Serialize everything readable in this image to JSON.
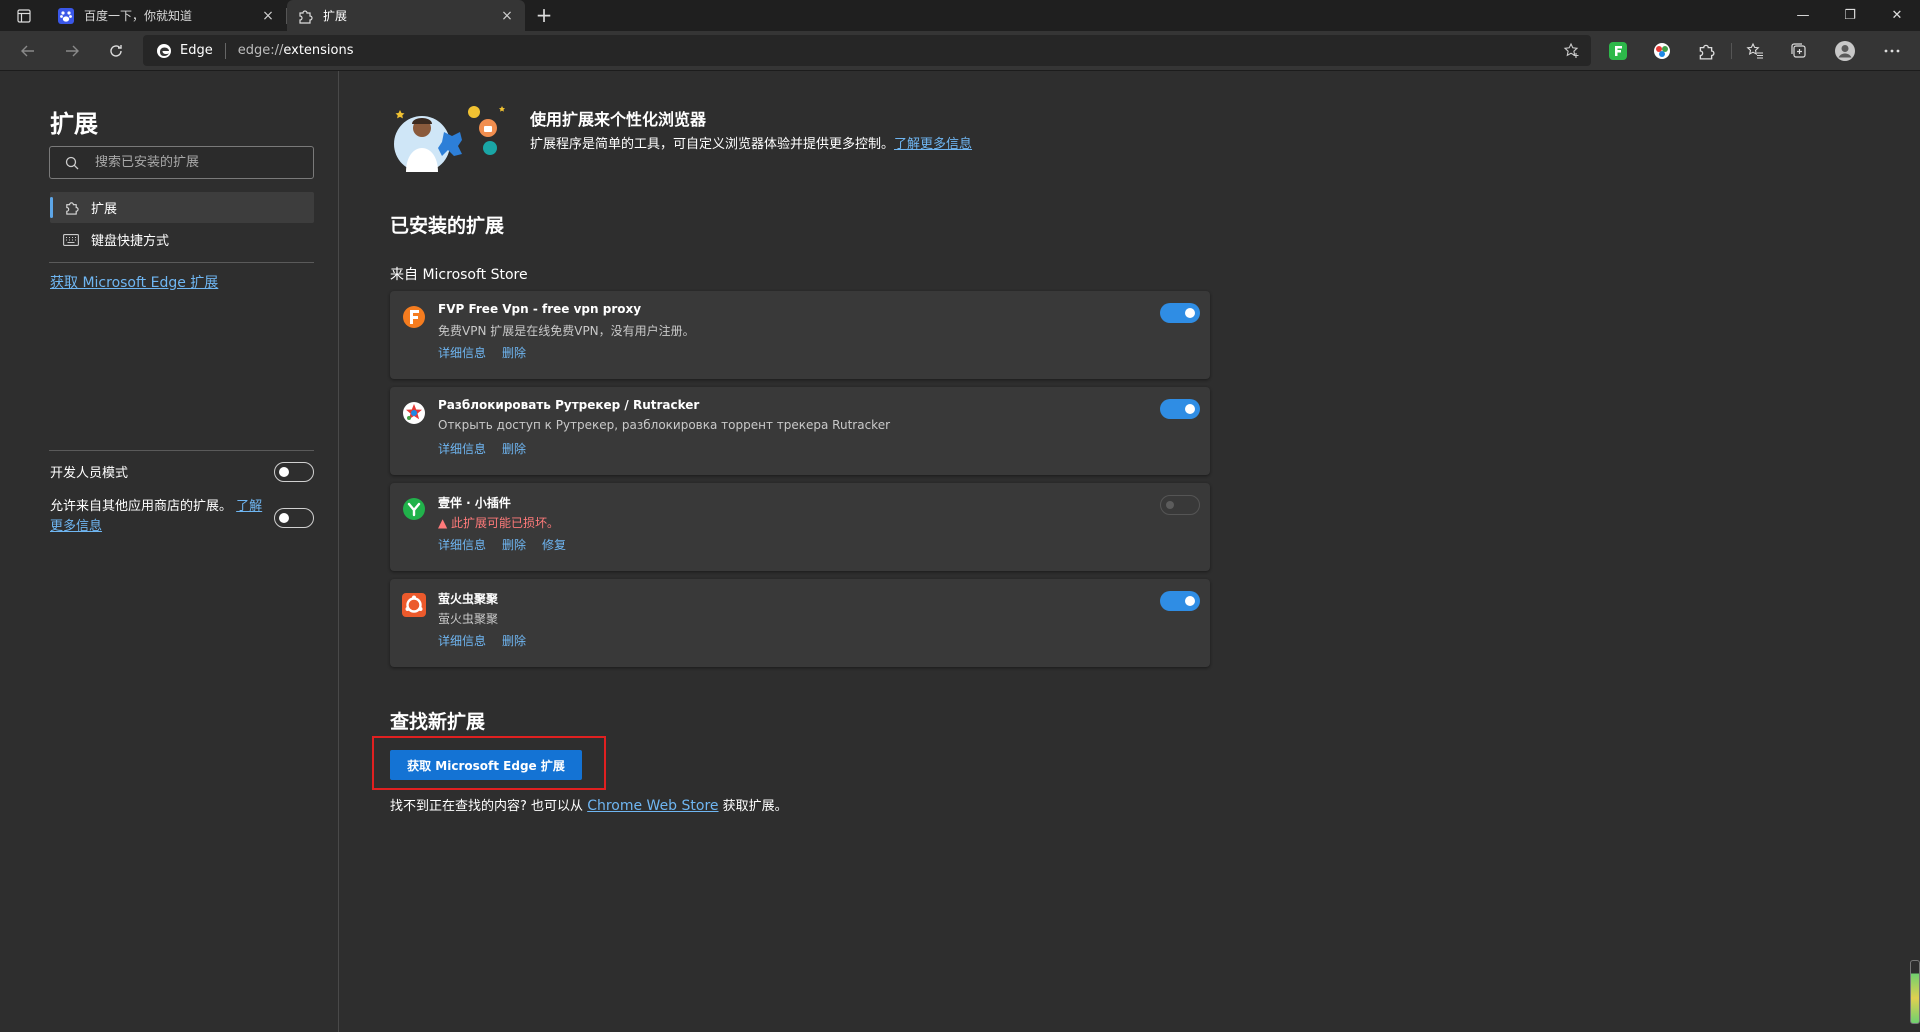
{
  "tabs": [
    {
      "title": "百度一下，你就知道",
      "close": "×"
    },
    {
      "title": "扩展",
      "close": "×"
    }
  ],
  "new_tab": "+",
  "window_controls": {
    "minimize": "—",
    "restore": "❐",
    "close": "✕"
  },
  "address_bar": {
    "site_name": "Edge",
    "url_scheme": "edge://",
    "url_path": "extensions"
  },
  "sidebar": {
    "title": "扩展",
    "search_placeholder": "搜索已安装的扩展",
    "items": [
      {
        "label": "扩展",
        "icon": "extensions-puzzle-icon",
        "active": true
      },
      {
        "label": "键盘快捷方式",
        "icon": "keyboard-icon",
        "active": false
      }
    ],
    "get_link": "获取 Microsoft Edge 扩展",
    "dev_mode_label": "开发人员模式",
    "dev_mode_on": false,
    "allow_other_stores_label": "允许来自其他应用商店的扩展。",
    "allow_learn_more": "了解更多信息",
    "allow_other_stores_on": false
  },
  "main": {
    "hero_title": "使用扩展来个性化浏览器",
    "hero_desc": "扩展程序是简单的工具，可自定义浏览器体验并提供更多控制。",
    "hero_link": "了解更多信息",
    "installed_heading": "已安装的扩展",
    "store_label": "来自 Microsoft Store",
    "extensions": [
      {
        "name": "FVP Free Vpn - free vpn proxy",
        "desc": "免费VPN 扩展是在线免费VPN，没有用户注册。",
        "warning": false,
        "links": [
          "详细信息",
          "删除"
        ],
        "enabled": true,
        "icon": "fvp-logo-icon"
      },
      {
        "name": "Разблокировать Рутрекер / Rutracker",
        "desc": "Открыть доступ к Рутрекер, разблокировка торрент трекера Rutracker",
        "warning": false,
        "links": [
          "详细信息",
          "删除"
        ],
        "enabled": true,
        "icon": "rutracker-logo-icon"
      },
      {
        "name": "壹伴 · 小插件",
        "desc": "此扩展可能已损坏。",
        "warning": true,
        "links": [
          "详细信息",
          "删除",
          "修复"
        ],
        "enabled": false,
        "icon": "yiban-logo-icon"
      },
      {
        "name": "萤火虫聚聚",
        "desc": "萤火虫聚聚",
        "warning": false,
        "links": [
          "详细信息",
          "删除"
        ],
        "enabled": true,
        "icon": "firefly-logo-icon"
      }
    ],
    "find_heading": "查找新扩展",
    "get_button": "获取 Microsoft Edge 扩展",
    "footer_prefix": "找不到正在查找的内容? 也可以从",
    "footer_link": "Chrome Web Store",
    "footer_suffix": "获取扩展。"
  },
  "colors": {
    "accent": "#1473d4",
    "link": "#6fb6f2",
    "toggle_on": "#2f8de4",
    "warning": "#ff7a7a",
    "highlight_box": "#e02020"
  }
}
